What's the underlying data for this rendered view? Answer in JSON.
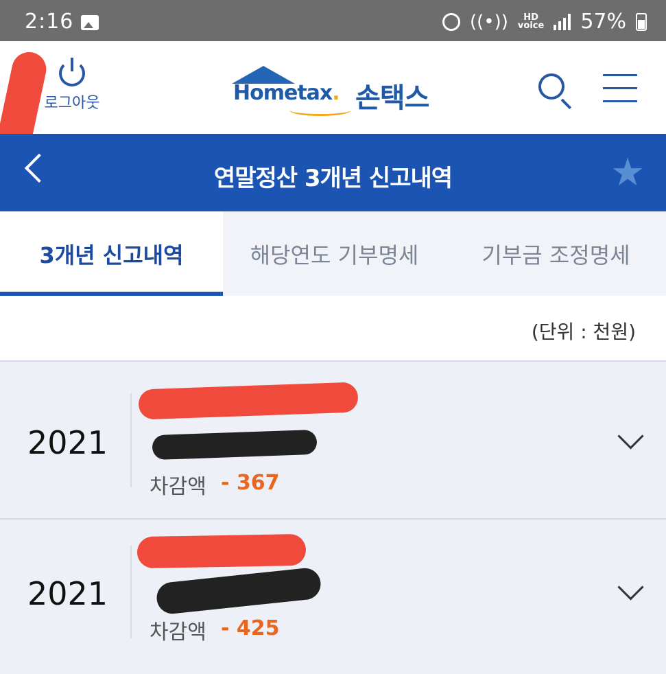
{
  "status_bar": {
    "time": "2:16",
    "hd_label": "HD",
    "voice_label": "voice",
    "battery": "57%"
  },
  "header": {
    "logout_label": "로그아웃",
    "logo_brand": "Hometax",
    "logo_korean": "손택스"
  },
  "titlebar": {
    "title": "연말정산 3개년 신고내역"
  },
  "tabs": [
    {
      "label": "3개년 신고내역",
      "active": true
    },
    {
      "label": "해당연도 기부명세",
      "active": false
    },
    {
      "label": "기부금 조정명세",
      "active": false
    }
  ],
  "unit_label": "(단위 : 천원)",
  "records": [
    {
      "year": "2021",
      "deduction_label": "차감액",
      "deduction_value": "- 367"
    },
    {
      "year": "2021",
      "deduction_label": "차감액",
      "deduction_value": "- 425"
    }
  ],
  "colors": {
    "status_bar": "#6d6d6d",
    "brand_blue": "#1c54b3",
    "accent_orange": "#e8661e",
    "list_bg": "#eef0f7"
  }
}
